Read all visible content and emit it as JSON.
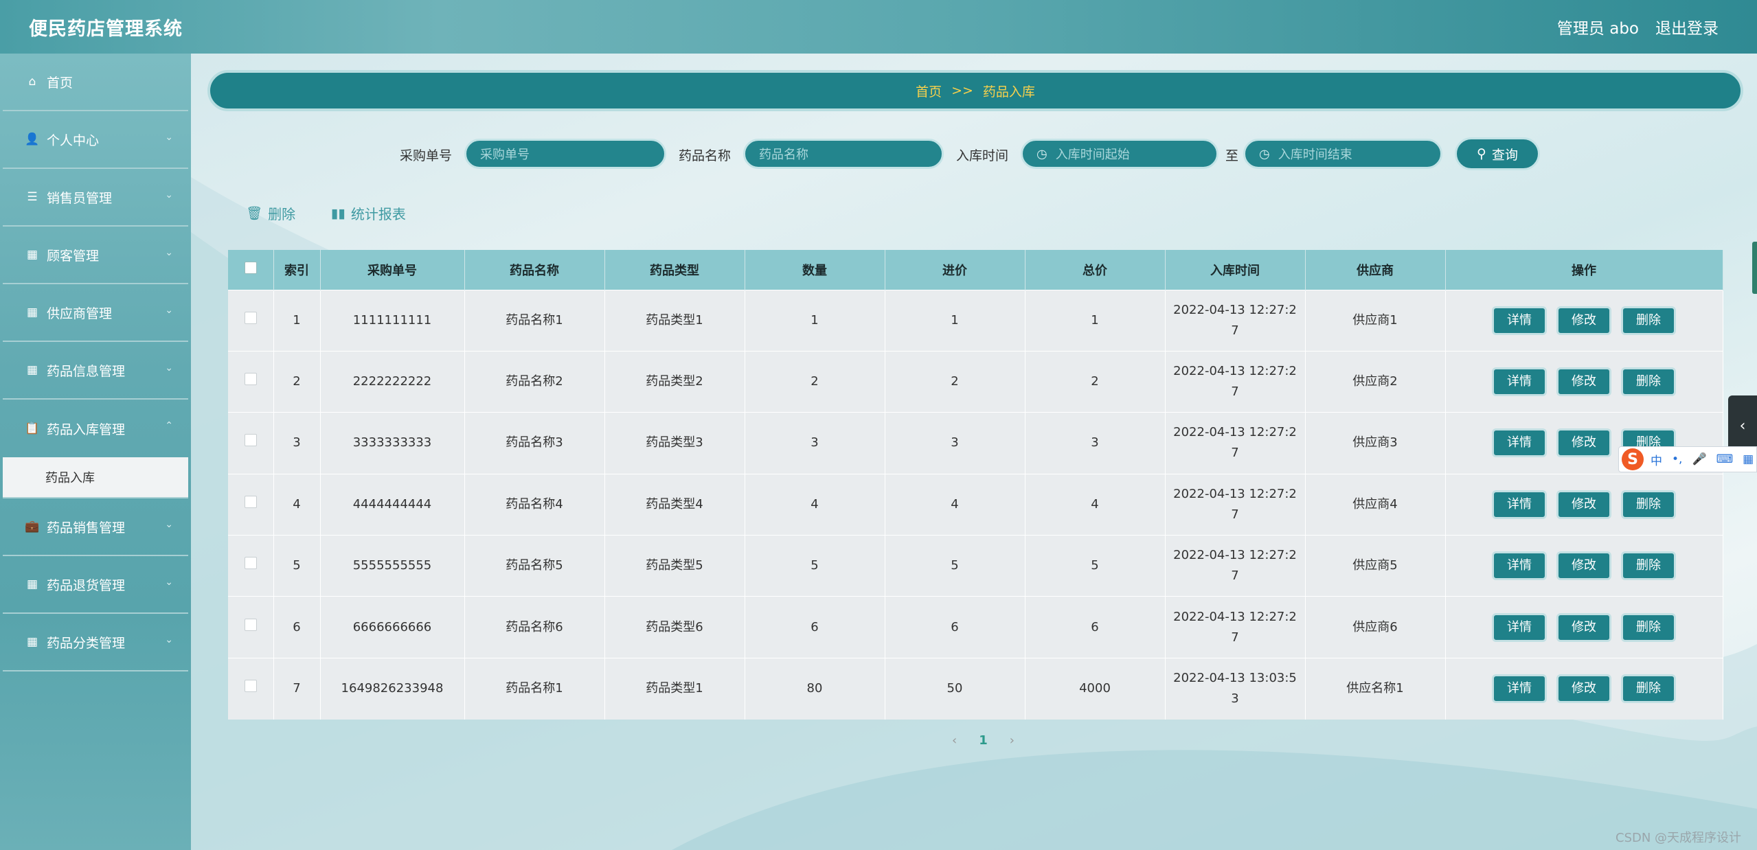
{
  "app": {
    "title": "便民药店管理系统",
    "admin_label": "管理员 abo",
    "logout": "退出登录"
  },
  "sidebar": {
    "items": [
      {
        "label": "首页",
        "icon": "home-icon"
      },
      {
        "label": "个人中心",
        "icon": "user-icon"
      },
      {
        "label": "销售员管理",
        "icon": "list-icon"
      },
      {
        "label": "顾客管理",
        "icon": "grid-icon"
      },
      {
        "label": "供应商管理",
        "icon": "grid-icon"
      },
      {
        "label": "药品信息管理",
        "icon": "grid-icon"
      },
      {
        "label": "药品入库管理",
        "icon": "clipboard-icon"
      },
      {
        "label": "药品销售管理",
        "icon": "briefcase-icon"
      },
      {
        "label": "药品退货管理",
        "icon": "grid-icon"
      },
      {
        "label": "药品分类管理",
        "icon": "grid-icon"
      }
    ],
    "active_sub": "药品入库"
  },
  "breadcrumb": {
    "home": "首页",
    "sep": ">>",
    "current": "药品入库"
  },
  "search": {
    "order_label": "采购单号",
    "order_placeholder": "采购单号",
    "name_label": "药品名称",
    "name_placeholder": "药品名称",
    "time_label": "入库时间",
    "time_start_placeholder": "入库时间起始",
    "to_label": "至",
    "time_end_placeholder": "入库时间结束",
    "query_label": "查询"
  },
  "toolbar": {
    "delete_label": "删除",
    "stats_label": "统计报表"
  },
  "table": {
    "headers": [
      "索引",
      "采购单号",
      "药品名称",
      "药品类型",
      "数量",
      "进价",
      "总价",
      "入库时间",
      "供应商",
      "操作"
    ],
    "rows": [
      {
        "idx": "1",
        "order": "1111111111",
        "name": "药品名称1",
        "type": "药品类型1",
        "qty": "1",
        "price": "1",
        "total": "1",
        "time": "2022-04-13 12:27:27",
        "supplier": "供应商1"
      },
      {
        "idx": "2",
        "order": "2222222222",
        "name": "药品名称2",
        "type": "药品类型2",
        "qty": "2",
        "price": "2",
        "total": "2",
        "time": "2022-04-13 12:27:27",
        "supplier": "供应商2"
      },
      {
        "idx": "3",
        "order": "3333333333",
        "name": "药品名称3",
        "type": "药品类型3",
        "qty": "3",
        "price": "3",
        "total": "3",
        "time": "2022-04-13 12:27:27",
        "supplier": "供应商3"
      },
      {
        "idx": "4",
        "order": "4444444444",
        "name": "药品名称4",
        "type": "药品类型4",
        "qty": "4",
        "price": "4",
        "total": "4",
        "time": "2022-04-13 12:27:27",
        "supplier": "供应商4"
      },
      {
        "idx": "5",
        "order": "5555555555",
        "name": "药品名称5",
        "type": "药品类型5",
        "qty": "5",
        "price": "5",
        "total": "5",
        "time": "2022-04-13 12:27:27",
        "supplier": "供应商5"
      },
      {
        "idx": "6",
        "order": "6666666666",
        "name": "药品名称6",
        "type": "药品类型6",
        "qty": "6",
        "price": "6",
        "total": "6",
        "time": "2022-04-13 12:27:27",
        "supplier": "供应商6"
      },
      {
        "idx": "7",
        "order": "1649826233948",
        "name": "药品名称1",
        "type": "药品类型1",
        "qty": "80",
        "price": "50",
        "total": "4000",
        "time": "2022-04-13 13:03:53",
        "supplier": "供应名称1"
      }
    ],
    "actions": {
      "detail": "详情",
      "edit": "修改",
      "delete": "删除"
    }
  },
  "pagination": {
    "prev": "‹",
    "current": "1",
    "next": "›"
  },
  "ime": {
    "logo": "S",
    "mode": "中",
    "punct": "•,"
  },
  "watermark": "CSDN @天成程序设计",
  "colors": {
    "header": "#4a9ea6",
    "accent": "#1f8189",
    "breadcrumb_text": "#f7d14c",
    "table_header": "#8ac8ce"
  }
}
